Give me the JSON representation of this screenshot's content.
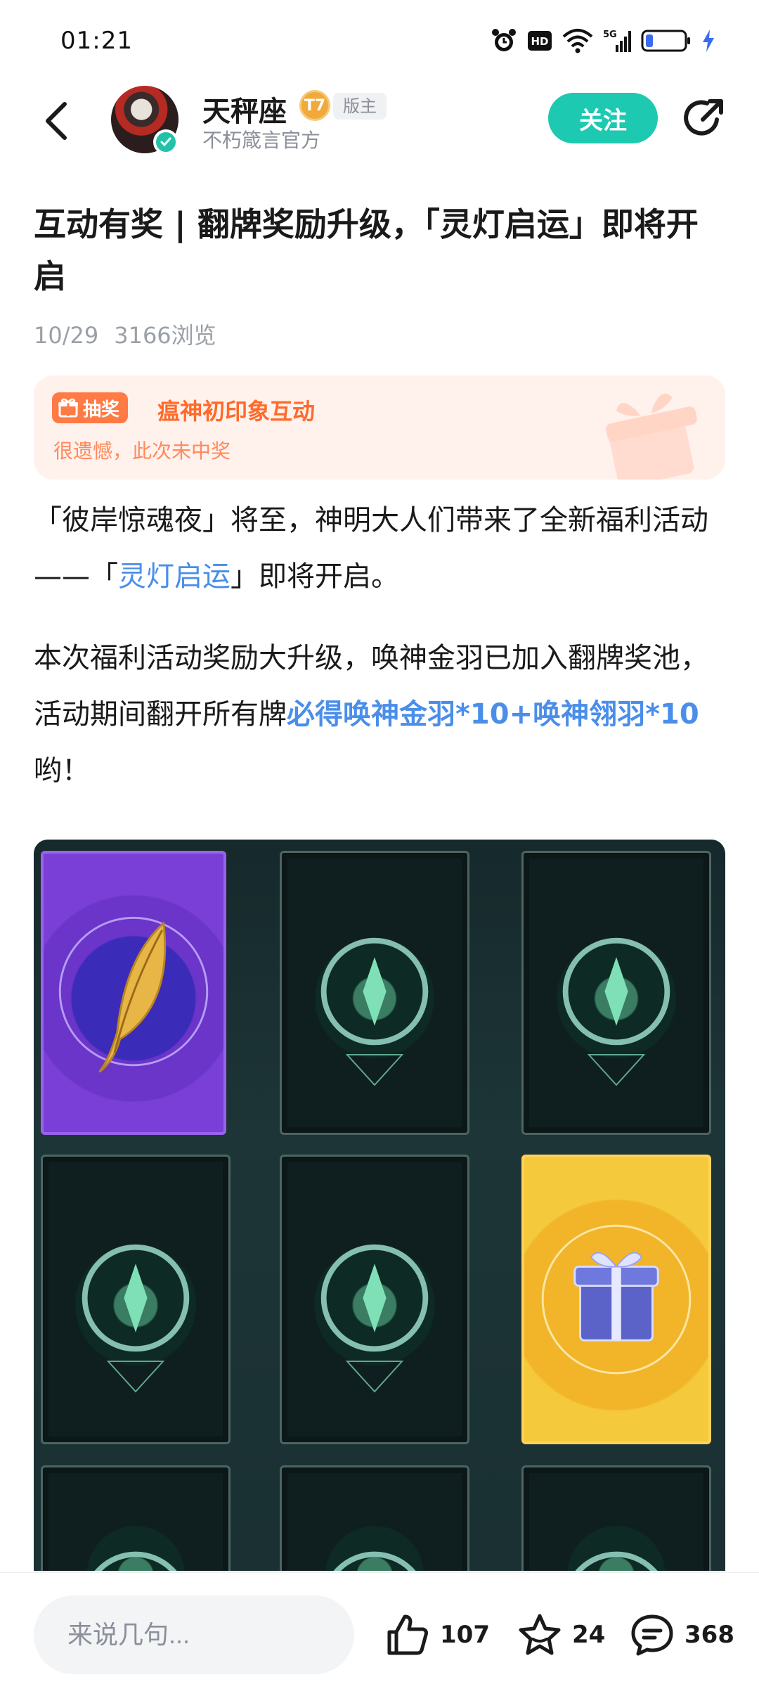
{
  "status_bar": {
    "time": "01:21"
  },
  "author": {
    "name": "天秤座",
    "level": "7",
    "role": "版主",
    "subtitle": "不朽箴言官方",
    "follow_label": "关注"
  },
  "post": {
    "title": "互动有奖 | 翻牌奖励升级，「灵灯启运」即将开启",
    "date": "10/29",
    "views": "3166浏览",
    "lottery": {
      "tag": "抽奖",
      "title": "瘟神初印象互动",
      "result": "很遗憾，此次未中奖"
    },
    "para1": {
      "prefix": "「彼岸惊魂夜」将至，神明大人们带来了全新福利活动——「",
      "highlight": "灵灯启运",
      "suffix": "」即将开启。"
    },
    "para2": {
      "prefix": "本次福利活动奖励大升级，唤神金羽已加入翻牌奖池，活动期间翻开所有牌",
      "highlight": "必得唤神金羽*10+唤神翎羽*10",
      "suffix": "哟！"
    }
  },
  "bottom_bar": {
    "comment_placeholder": "来说几句...",
    "likes": "107",
    "favorites": "24",
    "comments": "368"
  },
  "colors": {
    "accent": "#1dc9b1",
    "link": "#4a8eea",
    "lottery_orange": "#ff6a2a"
  },
  "icons": [
    "back-icon",
    "share-icon",
    "verified-icon",
    "gift-icon",
    "like-icon",
    "star-icon",
    "comment-icon",
    "alarm-icon",
    "hd-icon",
    "wifi-icon",
    "signal-icon",
    "battery-icon",
    "charging-icon"
  ]
}
